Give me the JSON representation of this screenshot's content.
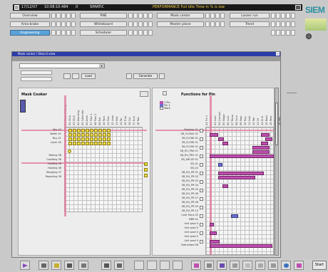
{
  "status_bar": {
    "date": "17/12/07",
    "time": "10:08:10.484",
    "number": "0",
    "app": "SIMATIC",
    "message": "PERFORMANCE Full Idle Time in % is low"
  },
  "brand": {
    "logo_text": "SIEM"
  },
  "nav": {
    "col1": [
      "Overview",
      "Area brake",
      "Engineering"
    ],
    "col2": [
      "RNE",
      "Whiteboard",
      "Scheduler"
    ],
    "col3": [
      "Mask center",
      "Master plane"
    ],
    "col4": [
      "Lasser run",
      "Trend"
    ],
    "selected": "Engineering"
  },
  "window": {
    "title": "Mask center / Stencil view",
    "toolbar_btn_a": "Load",
    "toolbar_btn_b": "Generate"
  },
  "mask_cooker": {
    "title": "Mask Cooker",
    "columns": [
      "01 Mask Cooling",
      "02 CE-A",
      "03 CE-B",
      "04 Alarming",
      "05 Calibrate",
      "06 Area",
      "07 Plan 1",
      "08 Plan 2",
      "09 Ext",
      "10 Fam",
      "11 Plan",
      "12 Loop",
      "13 Stat",
      "14 Tar",
      "15 Trial",
      "16 Cut",
      "17 Ecol",
      "18 Res"
    ],
    "rows": [
      "Key 43",
      "Wafer 41",
      "Buy 41",
      "Layer 40",
      "",
      "",
      "Baking 38",
      "Coolding 38",
      "Hosting 38",
      "Hosting 38",
      "Stepping 37",
      "Repairing 36"
    ]
  },
  "functions_panel": {
    "title": "Functions for Pin",
    "columns": [
      "01 Pin 1",
      "02 Pin 2",
      "03 Inert",
      "04 Contact",
      "05 Stage",
      "06 Lock",
      "07 Temp",
      "08 Cure",
      "09 Pass",
      "10 Rng",
      "11 Cool",
      "12 Ret",
      "13 Ctl",
      "14 Grid",
      "15 Back",
      "16 Rem",
      "17 End",
      "18 Res"
    ],
    "rows": [
      "Resistor 01",
      "SB_FLOWU 01",
      "SB_FLOWI 01",
      "SB_FLOWI 01",
      "SB_FLOWI 01",
      "SB_RU_PRA 01",
      "SB_RU_PR2 01",
      "SB_ARCGP 01",
      "SB_01",
      "SB_02",
      "SB_RU_PR 01",
      "SB_RU_PR 02",
      "SB_RU_PR 03",
      "SB_RU_PR 04",
      "SB_RU_PR 05",
      "SB_RU_PR 06",
      "SB_RU_PR 07",
      "SB_RU_PR 08",
      "SB_RU_PR 09",
      "SB_RU_PR 10",
      "Cold Trans 03",
      "NBR 01",
      "Unit prod 0",
      "Unit prod 0",
      "Unit prod 0",
      "Unit prod 0",
      "Unit prod 0",
      "Fabricated 08"
    ]
  },
  "legend": {
    "items": [
      {
        "label": "1 Pin",
        "color": "#c04fb0"
      },
      {
        "label": "Pin 2",
        "color": "#6a6fd0"
      },
      {
        "label": "Mark",
        "color": "#ffffff"
      }
    ]
  },
  "bottom": {
    "exit_label": "Start"
  },
  "colors": {
    "selected_nav": "#5aa2d8",
    "highlight": "#e07a9e",
    "yellow": "#eedd44",
    "magenta": "#c04fb0",
    "blue": "#6a6fd0"
  }
}
